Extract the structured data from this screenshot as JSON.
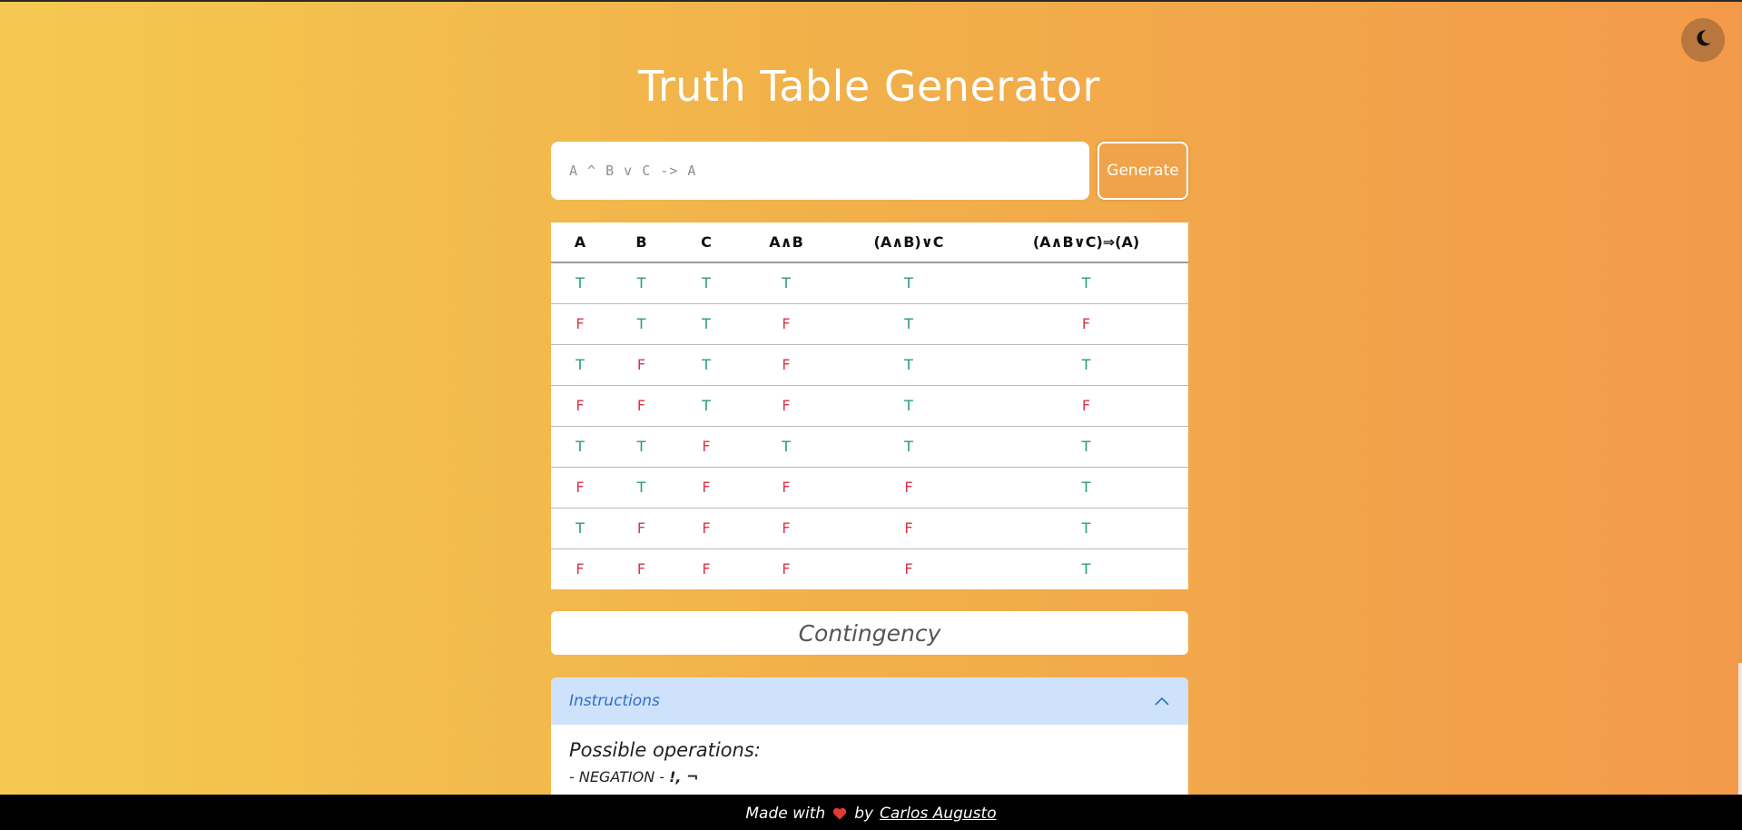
{
  "header": {
    "title": "Truth Table Generator",
    "theme_toggle_icon": "moon-icon"
  },
  "input": {
    "placeholder": "A ^ B v C -> A",
    "value": "",
    "generate_label": "Generate"
  },
  "table": {
    "columns": [
      "A",
      "B",
      "C",
      "A∧B",
      "(A∧B)∨C",
      "(A∧B∨C)⇒(A)"
    ],
    "rows": [
      [
        "T",
        "T",
        "T",
        "T",
        "T",
        "T"
      ],
      [
        "F",
        "T",
        "T",
        "F",
        "T",
        "F"
      ],
      [
        "T",
        "F",
        "T",
        "F",
        "T",
        "T"
      ],
      [
        "F",
        "F",
        "T",
        "F",
        "T",
        "F"
      ],
      [
        "T",
        "T",
        "F",
        "T",
        "T",
        "T"
      ],
      [
        "F",
        "T",
        "F",
        "F",
        "F",
        "T"
      ],
      [
        "T",
        "F",
        "F",
        "F",
        "F",
        "T"
      ],
      [
        "F",
        "F",
        "F",
        "F",
        "F",
        "T"
      ]
    ],
    "colors": {
      "T": "#2a9d6e",
      "F": "#d8344a"
    }
  },
  "result": {
    "label": "Contingency"
  },
  "instructions": {
    "title": "Instructions",
    "expanded": true,
    "toggle_icon": "chevron-up-icon",
    "heading": "Possible operations:",
    "operations": [
      {
        "name": "- NEGATION -",
        "symbols": "!, ¬"
      }
    ]
  },
  "footer": {
    "made_with": "Made with",
    "heart_icon": "heart-icon",
    "by": "by",
    "author": "Carlos Augusto"
  },
  "colors": {
    "accent": "#f0a34a",
    "instructions_header": "#cfe2fb",
    "instructions_title": "#2d6fc9"
  }
}
